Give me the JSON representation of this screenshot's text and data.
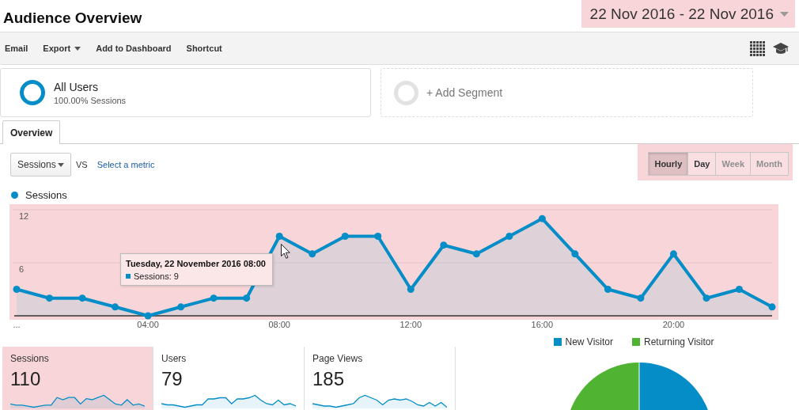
{
  "header": {
    "title": "Audience Overview",
    "date_range": {
      "label": "22 Nov 2016 - 22 Nov 2016",
      "highlighted": true
    }
  },
  "toolbar": {
    "actions": [
      {
        "label": "Email",
        "has_menu": false
      },
      {
        "label": "Export",
        "has_menu": true
      },
      {
        "label": "Add to Dashboard",
        "has_menu": false
      },
      {
        "label": "Shortcut",
        "has_menu": false
      }
    ]
  },
  "segments": [
    {
      "kind": "active",
      "name": "All Users",
      "detail": "100.00% Sessions"
    },
    {
      "kind": "add",
      "name": "+ Add Segment"
    }
  ],
  "tabs": [
    {
      "label": "Overview",
      "selected": true
    }
  ],
  "metric_picker": {
    "value": "Sessions",
    "vs": "VS",
    "link": "Select a metric"
  },
  "intervals": {
    "highlighted": true,
    "options": [
      {
        "label": "Hourly",
        "selected": true,
        "disabled": false
      },
      {
        "label": "Day",
        "selected": false,
        "disabled": false
      },
      {
        "label": "Week",
        "selected": false,
        "disabled": true
      },
      {
        "label": "Month",
        "selected": false,
        "disabled": true
      }
    ]
  },
  "chart": {
    "highlighted": true,
    "chart_data": {
      "type": "area",
      "x": [
        0,
        1,
        2,
        3,
        4,
        5,
        6,
        7,
        8,
        9,
        10,
        11,
        12,
        13,
        14,
        15,
        16,
        17,
        18,
        19,
        20,
        21,
        22,
        23
      ],
      "series": [
        {
          "name": "Sessions",
          "color": "#058dc7",
          "values": [
            3,
            2,
            2,
            1,
            0,
            1,
            2,
            2,
            9,
            7,
            9,
            9,
            3,
            8,
            7,
            9,
            11,
            7,
            3,
            2,
            7,
            2,
            3,
            1
          ]
        }
      ],
      "xlim": [
        0,
        23
      ],
      "ylim": [
        0,
        12
      ],
      "yticks": [
        6,
        12
      ],
      "xticks": [
        {
          "value": 0,
          "label": "..."
        },
        {
          "value": 4,
          "label": "04:00"
        },
        {
          "value": 8,
          "label": "08:00"
        },
        {
          "value": 12,
          "label": "12:00"
        },
        {
          "value": 16,
          "label": "16:00"
        },
        {
          "value": 20,
          "label": "20:00"
        }
      ]
    },
    "tooltip": {
      "title": "Tuesday, 22 November 2016 08:00",
      "text": "Sessions: 9"
    }
  },
  "metrics": [
    {
      "label": "Sessions",
      "value": "110",
      "highlighted": true
    },
    {
      "label": "Users",
      "value": "79",
      "highlighted": false
    },
    {
      "label": "Page Views",
      "value": "185",
      "highlighted": false
    }
  ],
  "visitor_pie": {
    "legend": [
      {
        "label": "New Visitor",
        "color": "#058dc7"
      },
      {
        "label": "Returning Visitor",
        "color": "#50b432"
      }
    ]
  }
}
